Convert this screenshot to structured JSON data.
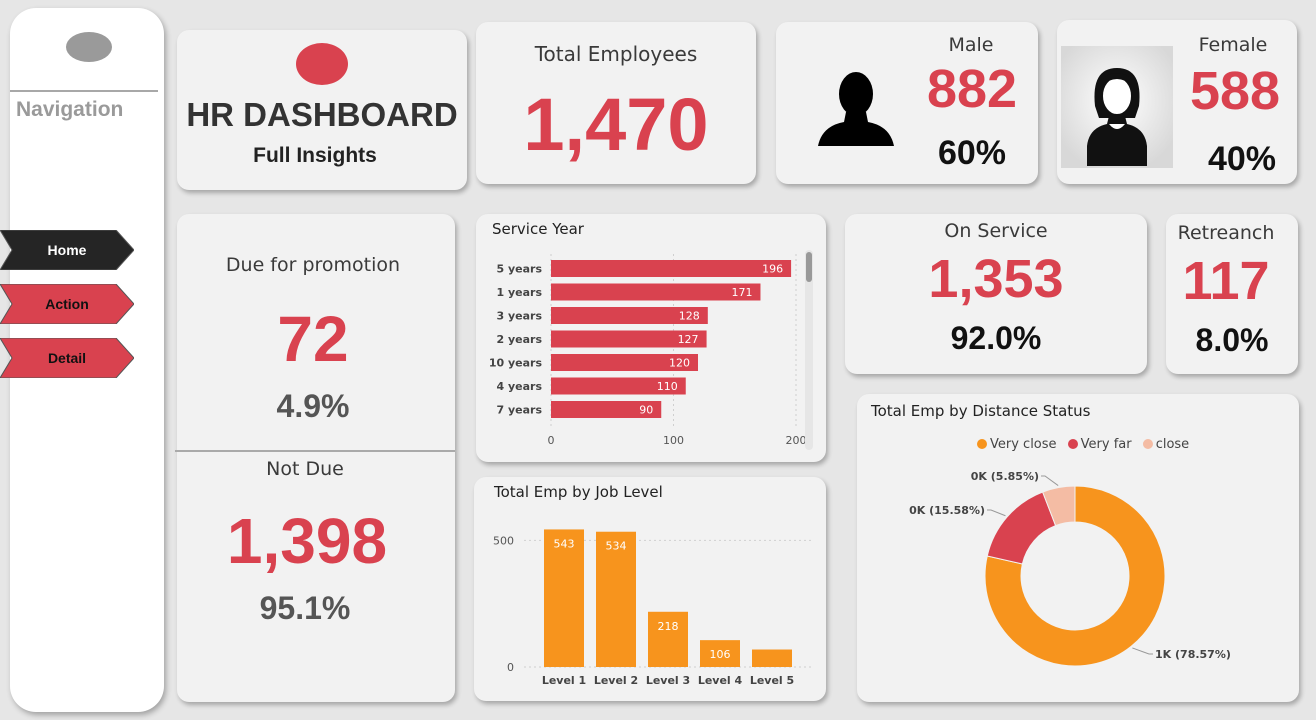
{
  "nav": {
    "title": "Navigation",
    "items": [
      {
        "label": "Home",
        "color": "#252525",
        "text_color": "#ffffff"
      },
      {
        "label": "Action",
        "color": "#d9424f",
        "text_color": "#111111"
      },
      {
        "label": "Detail",
        "color": "#d9424f",
        "text_color": "#111111"
      }
    ]
  },
  "header": {
    "title": "HR DASHBOARD",
    "subtitle": "Full Insights",
    "logo_color": "#d9424f"
  },
  "kpis": {
    "total": {
      "label": "Total Employees",
      "value": "1,470"
    },
    "male": {
      "label": "Male",
      "value": "882",
      "pct": "60%",
      "icon": "male-silhouette-icon"
    },
    "female": {
      "label": "Female",
      "value": "588",
      "pct": "40%",
      "icon": "female-avatar-icon"
    },
    "on_service": {
      "label": "On Service",
      "value": "1,353",
      "pct": "92.0%"
    },
    "retrench": {
      "label": "Retreanch",
      "value": "117",
      "pct": "8.0%"
    },
    "due": {
      "label": "Due for promotion",
      "value": "72",
      "pct": "4.9%"
    },
    "not_due": {
      "label": "Not Due",
      "value": "1,398",
      "pct": "95.1%"
    }
  },
  "colors": {
    "accent_red": "#d9424f",
    "orange": "#f7941d",
    "pink": "#f4bca4",
    "card": "#f2f2f2"
  },
  "chart_data": [
    {
      "type": "bar",
      "orientation": "horizontal",
      "title": "Service Year",
      "categories": [
        "5 years",
        "1 years",
        "3 years",
        "2 years",
        "10 years",
        "4 years",
        "7 years"
      ],
      "values": [
        196,
        171,
        128,
        127,
        120,
        110,
        90
      ],
      "xlim": [
        0,
        200
      ],
      "xticks": [
        0,
        100,
        200
      ],
      "color": "#d9424f"
    },
    {
      "type": "bar",
      "title": "Total Emp by Job Level",
      "categories": [
        "Level 1",
        "Level 2",
        "Level 3",
        "Level 4",
        "Level 5"
      ],
      "values": [
        543,
        534,
        218,
        106,
        69
      ],
      "value_labels": [
        "543",
        "534",
        "218",
        "106",
        ""
      ],
      "ylim": [
        0,
        600
      ],
      "yticks": [
        0,
        500
      ],
      "color": "#f7941d"
    },
    {
      "type": "pie",
      "donut": true,
      "title": "Total Emp by Distance Status",
      "labels": [
        "Very close",
        "Very far",
        "close"
      ],
      "values": [
        78.57,
        15.58,
        5.85
      ],
      "slice_labels": [
        "1K (78.57%)",
        "0K (15.58%)",
        "0K (5.85%)"
      ],
      "colors": [
        "#f7941d",
        "#d9424f",
        "#f4bca4"
      ],
      "legend": "top"
    }
  ]
}
